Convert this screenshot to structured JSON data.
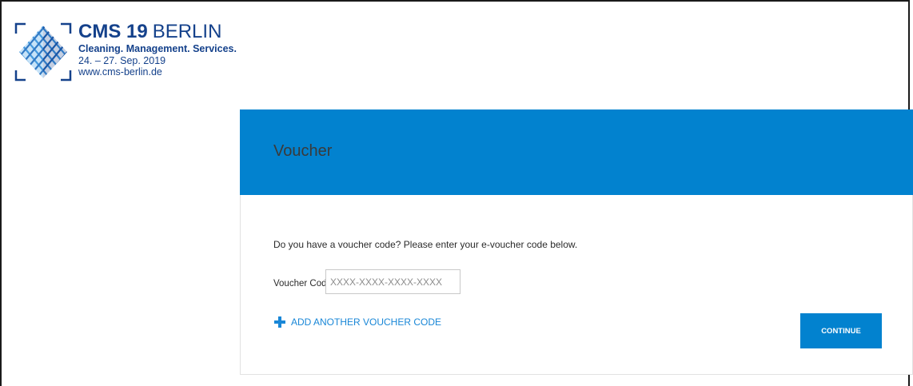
{
  "logo": {
    "title_bold": "CMS 19",
    "title_city": "BERLIN",
    "tagline": "Cleaning. Management. Services.",
    "dates": "24. – 27. Sep. 2019",
    "url": "www.cms-berlin.de",
    "brand_color": "#14418b",
    "icon": "cms-diamond-logo-icon"
  },
  "card": {
    "title": "Voucher",
    "header_color": "#0282cf",
    "prompt": "Do you have a voucher code? Please enter your e-voucher code below.",
    "field": {
      "label": "Voucher Code",
      "value": "",
      "placeholder": "XXXX-XXXX-XXXX-XXXX"
    },
    "add_link": {
      "icon": "plus-icon",
      "label": "ADD ANOTHER VOUCHER CODE"
    },
    "continue_label": "CONTINUE"
  }
}
